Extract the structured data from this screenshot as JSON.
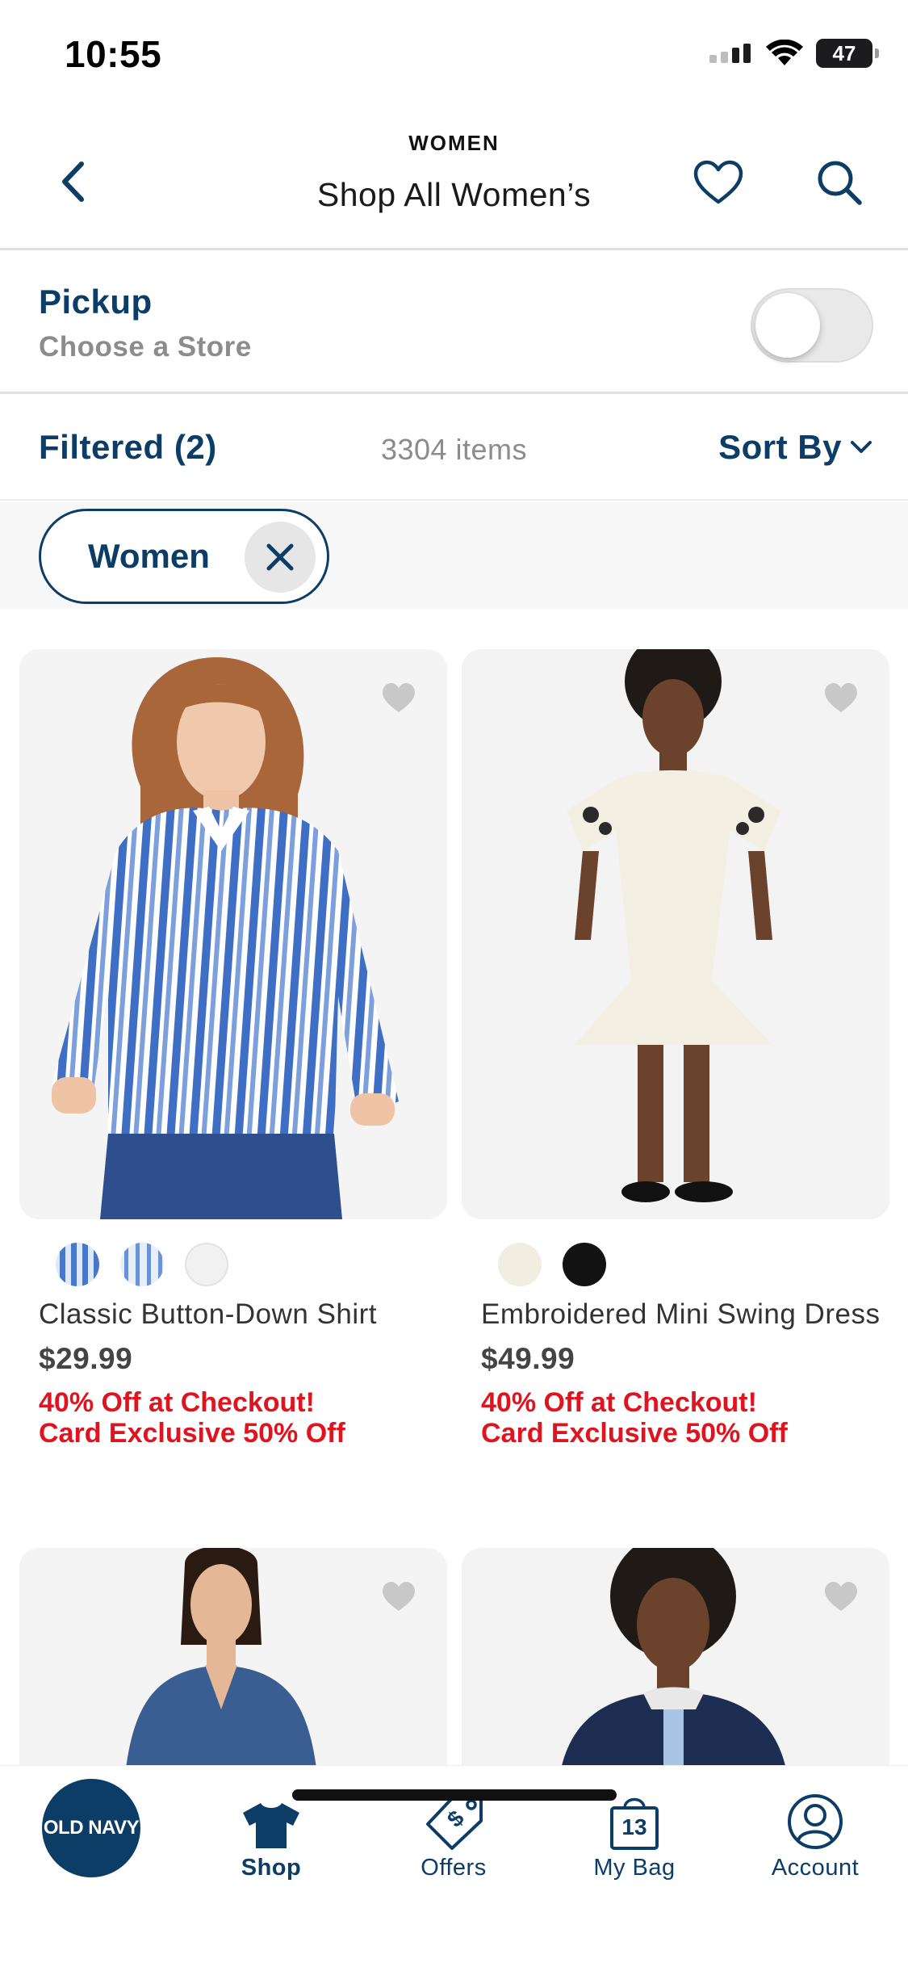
{
  "status_bar": {
    "time": "10:55",
    "battery": "47"
  },
  "header": {
    "eyebrow": "WOMEN",
    "title": "Shop All Women’s"
  },
  "pickup": {
    "title": "Pickup",
    "subtitle": "Choose a Store",
    "enabled": false
  },
  "filter_bar": {
    "filtered_label": "Filtered (2)",
    "item_count": "3304 items",
    "sort_label": "Sort By"
  },
  "active_filters": [
    {
      "label": "Women"
    }
  ],
  "products": [
    {
      "name": "Classic Button-Down Shirt",
      "price": "$29.99",
      "promo_1": "40% Off at Checkout!",
      "promo_2": "Card Exclusive 50% Off",
      "swatches": [
        "blue-stripe",
        "blue-stripe-light",
        "white"
      ]
    },
    {
      "name": "Embroidered Mini Swing Dress",
      "price": "$49.99",
      "promo_1": "40% Off at Checkout!",
      "promo_2": "Card Exclusive 50% Off",
      "swatches": [
        "cream",
        "black"
      ]
    },
    {
      "name": "",
      "price": ""
    },
    {
      "name": "",
      "price": ""
    }
  ],
  "bottom_nav": {
    "logo": "OLD NAVY",
    "items": [
      {
        "label": "Shop",
        "icon": "tshirt-icon",
        "active": true
      },
      {
        "label": "Offers",
        "icon": "price-tag-icon"
      },
      {
        "label": "My Bag",
        "icon": "shopping-bag-icon",
        "badge": "13"
      },
      {
        "label": "Account",
        "icon": "account-icon"
      }
    ]
  },
  "colors": {
    "brand_navy": "#0b3d66",
    "promo_red": "#e0141f",
    "muted_gray": "#8c8c8c"
  }
}
